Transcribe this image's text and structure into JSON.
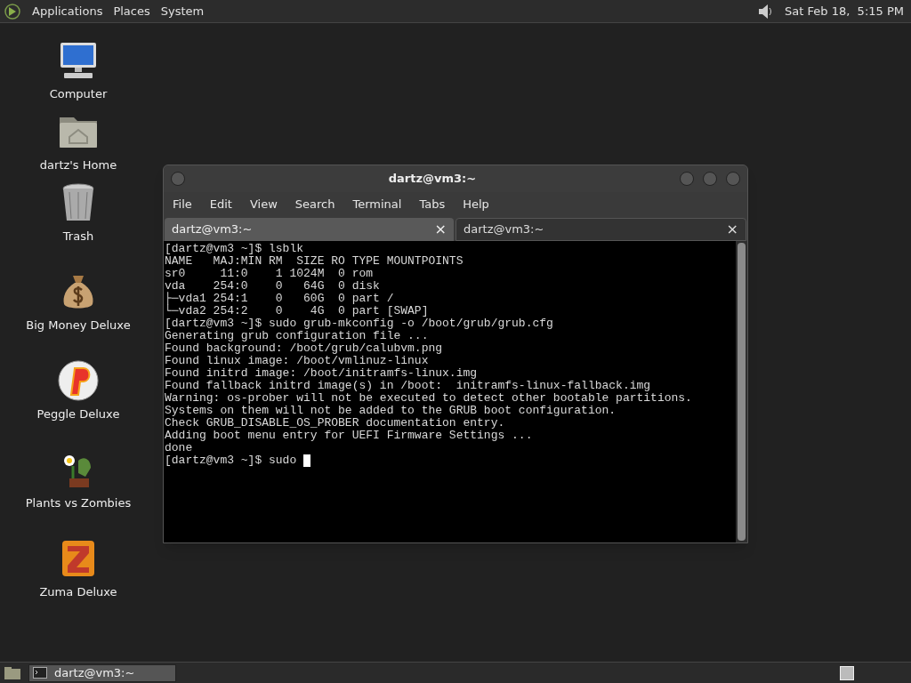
{
  "top_panel": {
    "menus": [
      "Applications",
      "Places",
      "System"
    ],
    "clock": "Sat Feb 18,  5:15 PM"
  },
  "desktop_icons": [
    {
      "kind": "computer",
      "label": "Computer"
    },
    {
      "kind": "home",
      "label": "dartz's Home"
    },
    {
      "kind": "trash",
      "label": "Trash"
    },
    {
      "kind": "moneybag",
      "label": "Big Money Deluxe"
    },
    {
      "kind": "ball",
      "label": "Peggle Deluxe"
    },
    {
      "kind": "plant",
      "label": "Plants vs Zombies"
    },
    {
      "kind": "block",
      "label": "Zuma Deluxe"
    }
  ],
  "window": {
    "title": "dartz@vm3:~",
    "menu": [
      "File",
      "Edit",
      "View",
      "Search",
      "Terminal",
      "Tabs",
      "Help"
    ],
    "tabs": [
      {
        "label": "dartz@vm3:~",
        "close": "×",
        "selected": true
      },
      {
        "label": "dartz@vm3:~",
        "close": "×",
        "selected": false
      }
    ],
    "terminal_lines": [
      "[dartz@vm3 ~]$ lsblk",
      "NAME   MAJ:MIN RM  SIZE RO TYPE MOUNTPOINTS",
      "sr0     11:0    1 1024M  0 rom",
      "vda    254:0    0   64G  0 disk",
      "├─vda1 254:1    0   60G  0 part /",
      "└─vda2 254:2    0    4G  0 part [SWAP]",
      "[dartz@vm3 ~]$ sudo grub-mkconfig -o /boot/grub/grub.cfg",
      "Generating grub configuration file ...",
      "Found background: /boot/grub/calubvm.png",
      "Found linux image: /boot/vmlinuz-linux",
      "Found initrd image: /boot/initramfs-linux.img",
      "Found fallback initrd image(s) in /boot:  initramfs-linux-fallback.img",
      "Warning: os-prober will not be executed to detect other bootable partitions.",
      "Systems on them will not be added to the GRUB boot configuration.",
      "Check GRUB_DISABLE_OS_PROBER documentation entry.",
      "Adding boot menu entry for UEFI Firmware Settings ...",
      "done"
    ],
    "prompt": "[dartz@vm3 ~]$ sudo "
  },
  "taskbar": {
    "tasks": [
      {
        "label": "dartz@vm3:~",
        "selected": true
      }
    ]
  }
}
